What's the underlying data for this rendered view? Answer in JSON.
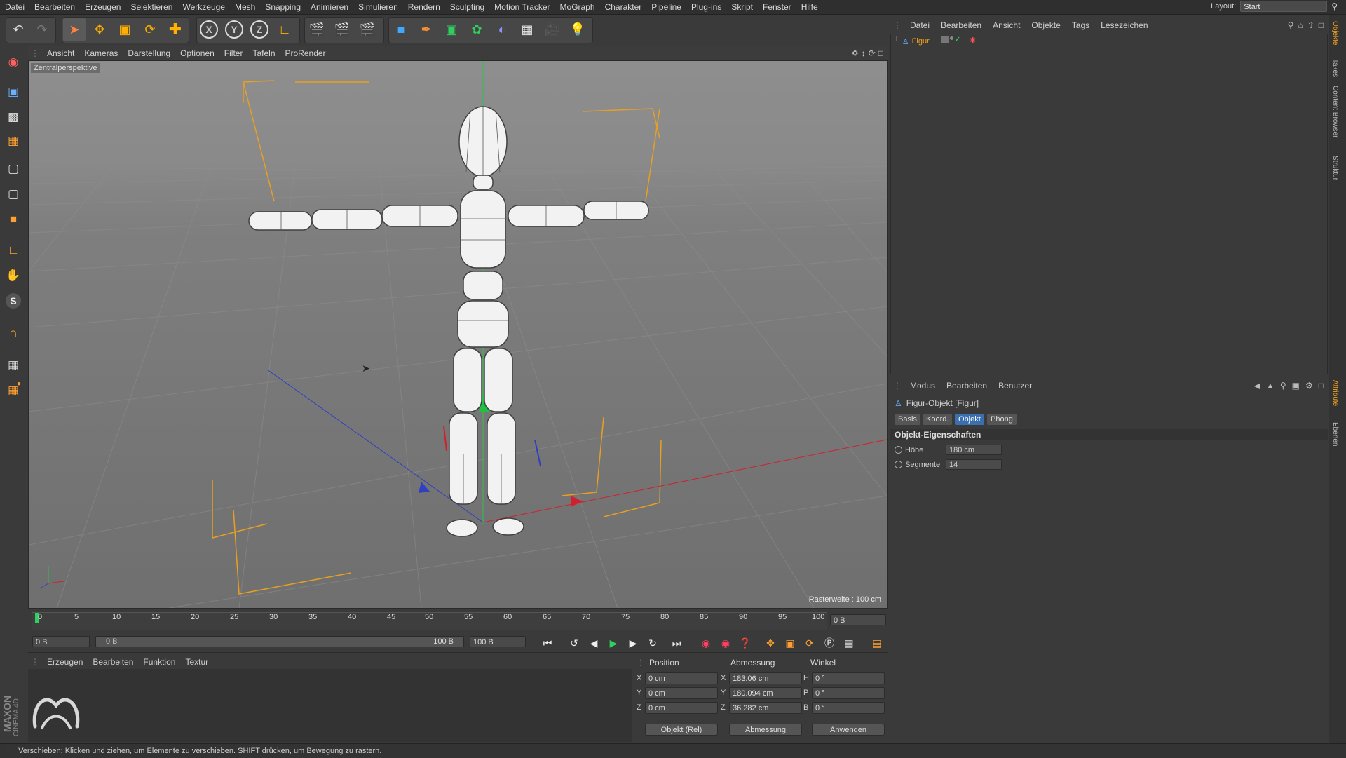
{
  "menubar": {
    "items": [
      "Datei",
      "Bearbeiten",
      "Erzeugen",
      "Selektieren",
      "Werkzeuge",
      "Mesh",
      "Snapping",
      "Animieren",
      "Simulieren",
      "Rendern",
      "Sculpting",
      "Motion Tracker",
      "MoGraph",
      "Charakter",
      "Pipeline",
      "Plug-ins",
      "Skript",
      "Fenster",
      "Hilfe"
    ],
    "layout_label": "Layout:",
    "layout_value": "Start"
  },
  "toolbar": {
    "icons": [
      "undo-icon",
      "redo-icon",
      "select-icon",
      "move-icon",
      "scale-icon",
      "rotate-icon",
      "add-icon",
      "x-axis-icon",
      "y-axis-icon",
      "z-axis-icon",
      "coordinate-system-icon",
      "render-view-icon",
      "render-picture-viewer-icon",
      "render-settings-icon",
      "cube-icon",
      "pen-icon",
      "subdivision-icon",
      "cloner-icon",
      "deformer-icon",
      "floor-icon",
      "camera-icon",
      "light-icon"
    ],
    "axis_labels": {
      "x": "X",
      "y": "Y",
      "z": "Z"
    }
  },
  "viewport": {
    "menu": [
      "Ansicht",
      "Kameras",
      "Darstellung",
      "Optionen",
      "Filter",
      "Tafeln",
      "ProRender"
    ],
    "perspective_label": "Zentralperspektive",
    "raster_label": "Rasterweite : 100 cm"
  },
  "timeline": {
    "ticks": [
      "0",
      "5",
      "10",
      "15",
      "20",
      "25",
      "30",
      "35",
      "40",
      "45",
      "50",
      "55",
      "60",
      "65",
      "70",
      "75",
      "80",
      "85",
      "90",
      "95",
      "100"
    ],
    "current_frame": "0 B",
    "start_field": "0 B",
    "range_start": "0 B",
    "range_end": "100 B",
    "end_field": "100 B"
  },
  "material_manager": {
    "menu": [
      "Erzeugen",
      "Bearbeiten",
      "Funktion",
      "Textur"
    ],
    "brand": "MAXON",
    "product": "CINEMA 4D"
  },
  "coordinates": {
    "headers": {
      "position": "Position",
      "size": "Abmessung",
      "rotation": "Winkel"
    },
    "rows": [
      {
        "axis": "X",
        "pos": "0 cm",
        "size_axis": "X",
        "size": "183.06 cm",
        "rot_axis": "H",
        "rot": "0 °"
      },
      {
        "axis": "Y",
        "pos": "0 cm",
        "size_axis": "Y",
        "size": "180.094 cm",
        "rot_axis": "P",
        "rot": "0 °"
      },
      {
        "axis": "Z",
        "pos": "0 cm",
        "size_axis": "Z",
        "size": "36.282 cm",
        "rot_axis": "B",
        "rot": "0 °"
      }
    ],
    "mode_dropdown": "Objekt (Rel)",
    "size_dropdown": "Abmessung",
    "apply_button": "Anwenden"
  },
  "object_manager": {
    "menu": [
      "Datei",
      "Bearbeiten",
      "Ansicht",
      "Objekte",
      "Tags",
      "Lesezeichen"
    ],
    "objects": [
      {
        "name": "Figur"
      }
    ]
  },
  "attribute_manager": {
    "menu": [
      "Modus",
      "Bearbeiten",
      "Benutzer"
    ],
    "title": "Figur-Objekt [Figur]",
    "tabs": [
      "Basis",
      "Koord.",
      "Objekt",
      "Phong"
    ],
    "active_tab": "Objekt",
    "section": "Objekt-Eigenschaften",
    "params": [
      {
        "label": "Höhe",
        "value": "180 cm"
      },
      {
        "label": "Segmente",
        "value": "14"
      }
    ]
  },
  "side_tabs": [
    "Objekte",
    "Takes",
    "Content Browser",
    "Struktur",
    "Attribute",
    "Ebenen"
  ],
  "status_bar": {
    "text": "Verschieben: Klicken und ziehen, um Elemente zu verschieben. SHIFT drücken, um Bewegung zu rastern."
  },
  "colors": {
    "accent_orange": "#f0a020",
    "axis_red": "#d02030",
    "axis_green": "#20c040",
    "axis_blue": "#3040c0",
    "selection_yellow": "#e8c020"
  }
}
